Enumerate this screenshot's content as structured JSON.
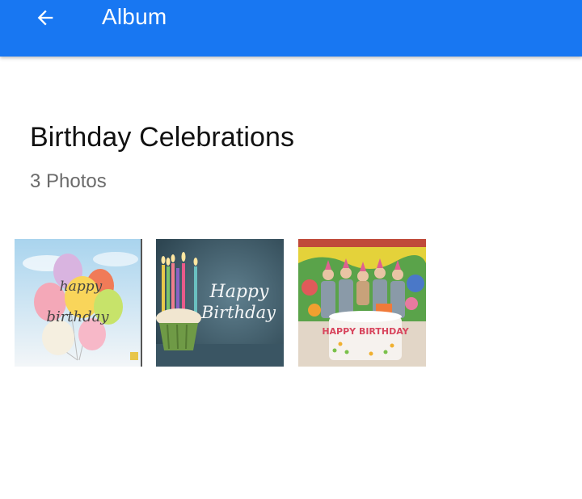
{
  "appbar": {
    "title": "Album",
    "back_icon": "arrow-back-icon",
    "color": "#1877F2"
  },
  "album": {
    "title": "Birthday Celebrations",
    "count_label": "3 Photos"
  },
  "photos": [
    {
      "name": "balloons-photo",
      "caption_lines": [
        "happy",
        "birthday"
      ]
    },
    {
      "name": "cupcake-candles-photo",
      "caption_lines": [
        "Happy",
        "Birthday"
      ]
    },
    {
      "name": "kids-cake-photo",
      "banner": "HAPPY BIRTHDAY"
    }
  ]
}
